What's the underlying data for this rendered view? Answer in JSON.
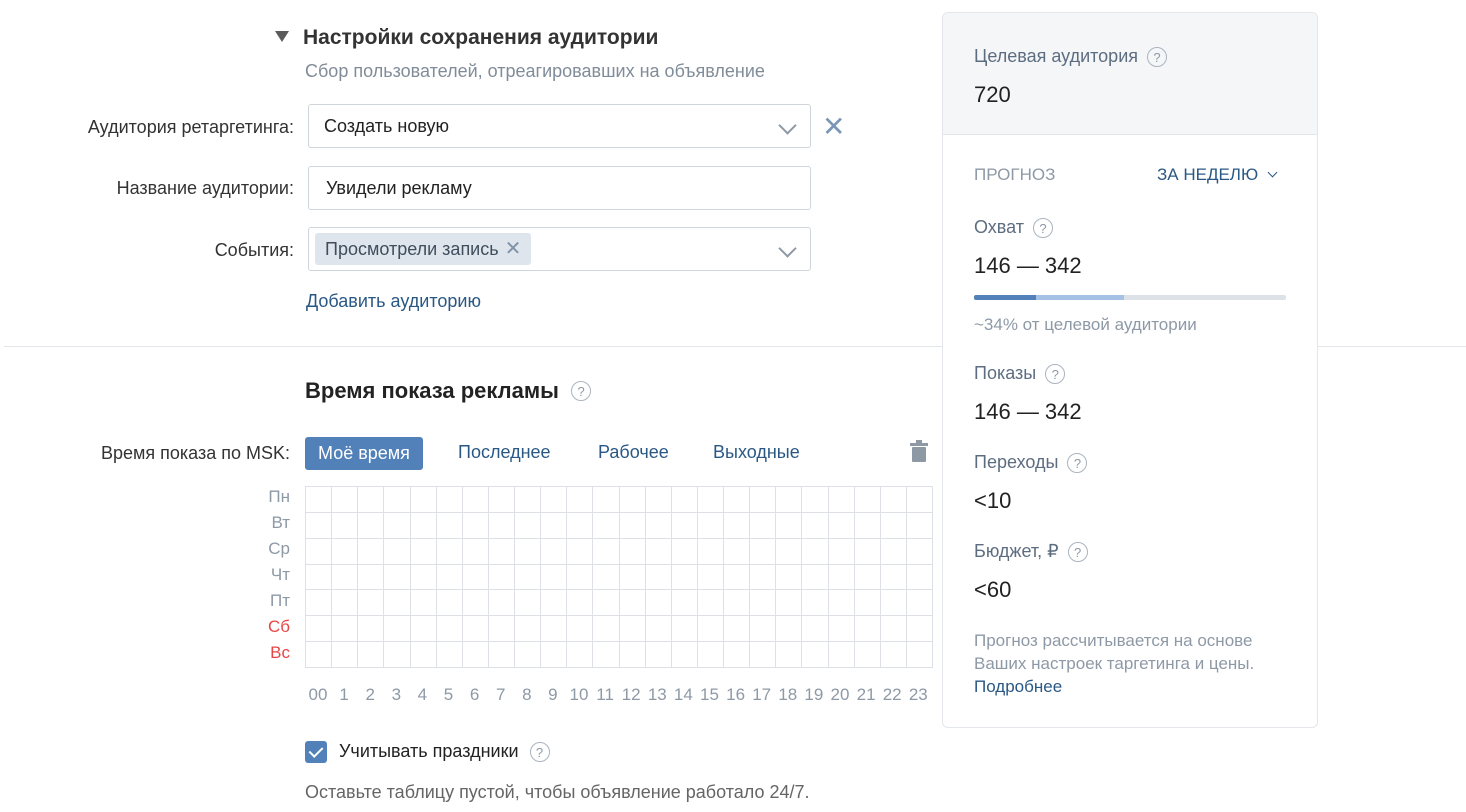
{
  "audience_settings": {
    "title": "Настройки сохранения аудитории",
    "subtitle": "Сбор пользователей, отреагировавших на объявление",
    "retargeting_label": "Аудитория ретаргетинга:",
    "retargeting_value": "Создать новую",
    "name_label": "Название аудитории:",
    "name_value": "Увидели рекламу",
    "events_label": "События:",
    "event_chip": "Просмотрели запись",
    "add_audience": "Добавить аудиторию"
  },
  "schedule": {
    "title": "Время показа рекламы",
    "time_label": "Время показа по MSK:",
    "tabs": [
      "Моё время",
      "Последнее",
      "Рабочее",
      "Выходные"
    ],
    "active_tab": "Моё время",
    "days": [
      "Пн",
      "Вт",
      "Ср",
      "Чт",
      "Пт",
      "Сб",
      "Вс"
    ],
    "weekend_color": "#e64646",
    "hours": [
      "00",
      "1",
      "2",
      "3",
      "4",
      "5",
      "6",
      "7",
      "8",
      "9",
      "10",
      "11",
      "12",
      "13",
      "14",
      "15",
      "16",
      "17",
      "18",
      "19",
      "20",
      "21",
      "22",
      "23"
    ],
    "holidays_label": "Учитывать праздники",
    "holidays_checked": true,
    "note": "Оставьте таблицу пустой, чтобы объявление работало 24/7."
  },
  "forecast": {
    "target_label": "Целевая аудитория",
    "target_value": "720",
    "forecast_label": "ПРОГНОЗ",
    "period": "ЗА НЕДЕЛЮ",
    "reach_label": "Охват",
    "reach_value": "146 — 342",
    "reach_bar_min_fraction": 0.2,
    "reach_bar_max_fraction": 0.48,
    "reach_caption": "~34% от целевой аудитории",
    "impressions_label": "Показы",
    "impressions_value": "146 — 342",
    "clicks_label": "Переходы",
    "clicks_value": "<10",
    "budget_label": "Бюджет, ₽",
    "budget_value": "<60",
    "caption": "Прогноз рассчитывается на основе Ваших настроек таргетинга и цены.",
    "more_link": "Подробнее"
  },
  "colors": {
    "accent": "#5181b8",
    "link": "#2a5885",
    "muted": "#818c99"
  }
}
